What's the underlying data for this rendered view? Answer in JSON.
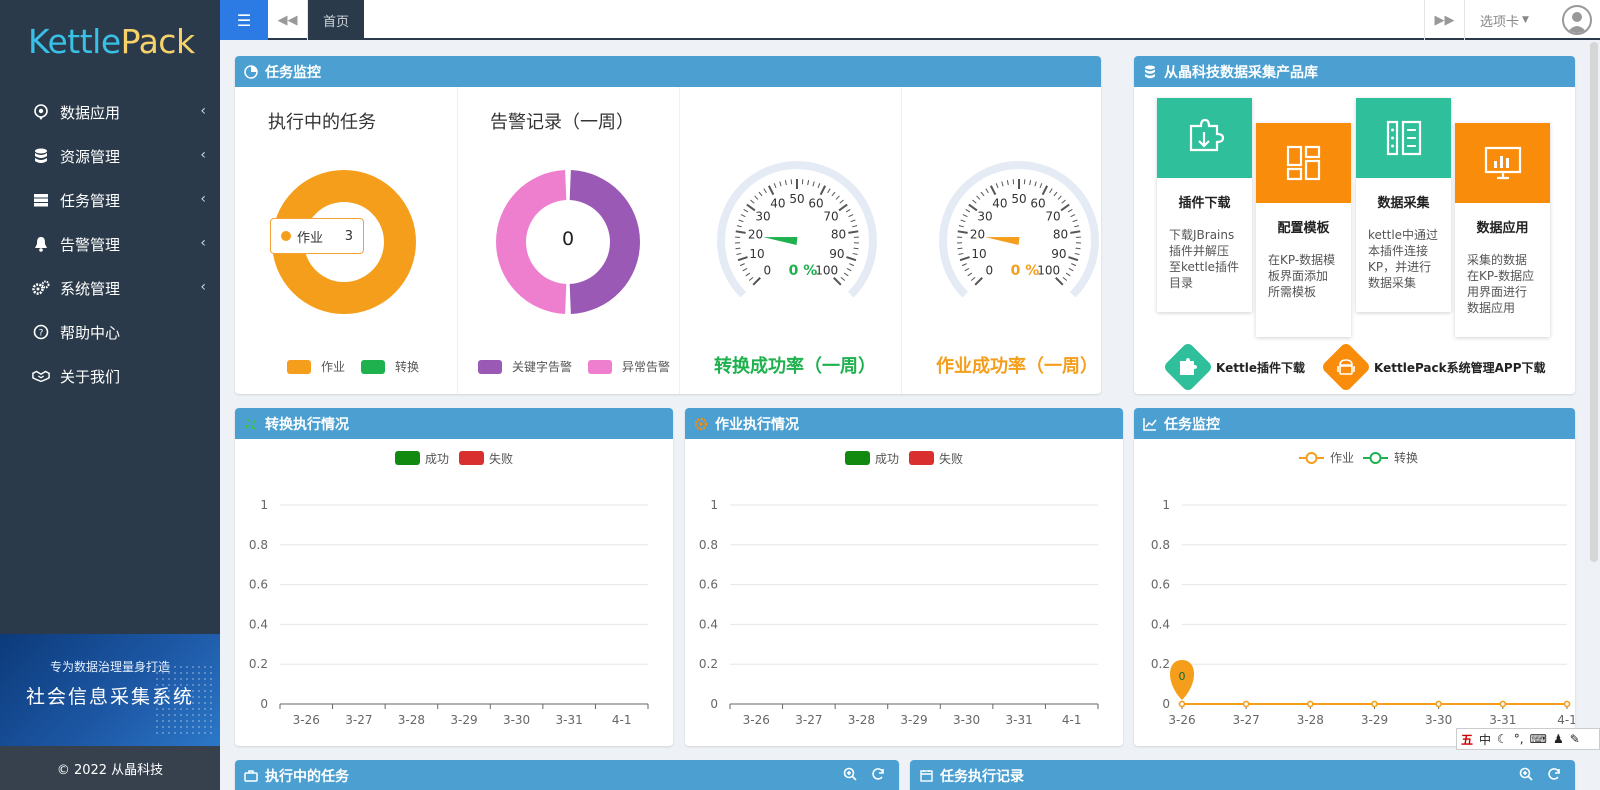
{
  "sidebar": {
    "logo_kettle": "Kettle",
    "logo_pack": "Pack",
    "items": [
      {
        "label": "数据应用",
        "icon": "location-pin-icon",
        "has_children": true
      },
      {
        "label": "资源管理",
        "icon": "database-icon",
        "has_children": true
      },
      {
        "label": "任务管理",
        "icon": "server-icon",
        "has_children": true
      },
      {
        "label": "告警管理",
        "icon": "bell-icon",
        "has_children": true
      },
      {
        "label": "系统管理",
        "icon": "gears-icon",
        "has_children": true
      },
      {
        "label": "帮助中心",
        "icon": "question-circle-icon",
        "has_children": false
      },
      {
        "label": "关于我们",
        "icon": "handshake-icon",
        "has_children": false
      }
    ],
    "banner_line1": "专为数据治理量身打造",
    "banner_line2": "社会信息采集系统",
    "footer": "© 2022 从晶科技"
  },
  "topbar": {
    "home_tab": "首页",
    "tab_dropdown": "选项卡"
  },
  "task_monitor": {
    "title": "任务监控",
    "running_title": "执行中的任务",
    "tooltip_label": "作业",
    "tooltip_value": "3",
    "running_legend": [
      "作业",
      "转换"
    ],
    "alarm_title": "告警记录（一周）",
    "alarm_value": "0",
    "alarm_legend": [
      "关键字告警",
      "异常告警"
    ],
    "transform_rate_label": "转换成功率（一周）",
    "job_rate_label": "作业成功率（一周）",
    "gauge_value_text": "0 %",
    "gauge_ticks": [
      "0",
      "10",
      "20",
      "30",
      "40",
      "50",
      "60",
      "70",
      "80",
      "90",
      "100"
    ]
  },
  "products": {
    "title": "从晶科技数据采集产品库",
    "cards": [
      {
        "title": "插件下载",
        "desc": "下载JBrains插件并解压至kettle插件目录",
        "color": "#2fbf9a"
      },
      {
        "title": "配置模板",
        "desc": "在KP-数据模板界面添加所需模板",
        "color": "#f98c0a"
      },
      {
        "title": "数据采集",
        "desc": "kettle中通过本插件连接KP，并进行数据采集",
        "color": "#2fbf9a"
      },
      {
        "title": "数据应用",
        "desc": "采集的数据在KP-数据应用界面进行数据应用",
        "color": "#f98c0a"
      }
    ],
    "download1": "Kettle插件下载",
    "download2": "KettlePack系统管理APP下载"
  },
  "charts": {
    "transform_exec": {
      "title": "转换执行情况",
      "legend": [
        "成功",
        "失败"
      ]
    },
    "job_exec": {
      "title": "作业执行情况",
      "legend": [
        "成功",
        "失败"
      ]
    },
    "monitor_line": {
      "title": "任务监控",
      "legend": [
        "作业",
        "转换"
      ],
      "marker_value": "0"
    }
  },
  "bottom": {
    "running_tasks": "执行中的任务",
    "task_records": "任务执行记录"
  },
  "ime": {
    "lang": "中"
  },
  "chart_data": [
    {
      "type": "pie",
      "categories": [
        "作业",
        "转换"
      ],
      "values": [
        3,
        0
      ],
      "colors": [
        "#f59e1b",
        "#1fb14e"
      ]
    },
    {
      "type": "pie",
      "categories": [
        "关键字告警",
        "异常告警"
      ],
      "values": [
        0,
        0
      ],
      "colors": [
        "#9b59b6",
        "#ee7fcf"
      ]
    },
    {
      "type": "gauge",
      "title": "转换成功率（一周）",
      "value": 0,
      "range": [
        0,
        100
      ],
      "color": "#1fb14e"
    },
    {
      "type": "gauge",
      "title": "作业成功率（一周）",
      "value": 0,
      "range": [
        0,
        100
      ],
      "color": "#f59e1b"
    },
    {
      "type": "bar",
      "categories": [
        "3-26",
        "3-27",
        "3-28",
        "3-29",
        "3-30",
        "3-31",
        "4-1"
      ],
      "series": [
        {
          "name": "成功",
          "values": [
            0,
            0,
            0,
            0,
            0,
            0,
            0
          ],
          "color": "#118a0f"
        },
        {
          "name": "失败",
          "values": [
            0,
            0,
            0,
            0,
            0,
            0,
            0
          ],
          "color": "#d92f2f"
        }
      ],
      "ylim": [
        0,
        1
      ],
      "yticks": [
        "0",
        "0.2",
        "0.4",
        "0.6",
        "0.8",
        "1"
      ],
      "legend": "top-center",
      "grid": true
    },
    {
      "type": "bar",
      "categories": [
        "3-26",
        "3-27",
        "3-28",
        "3-29",
        "3-30",
        "3-31",
        "4-1"
      ],
      "series": [
        {
          "name": "成功",
          "values": [
            0,
            0,
            0,
            0,
            0,
            0,
            0
          ],
          "color": "#118a0f"
        },
        {
          "name": "失败",
          "values": [
            0,
            0,
            0,
            0,
            0,
            0,
            0
          ],
          "color": "#d92f2f"
        }
      ],
      "ylim": [
        0,
        1
      ],
      "yticks": [
        "0",
        "0.2",
        "0.4",
        "0.6",
        "0.8",
        "1"
      ],
      "legend": "top-center",
      "grid": true
    },
    {
      "type": "line",
      "categories": [
        "3-26",
        "3-27",
        "3-28",
        "3-29",
        "3-30",
        "3-31",
        "4-1"
      ],
      "series": [
        {
          "name": "作业",
          "values": [
            0,
            0,
            0,
            0,
            0,
            0,
            0
          ],
          "color": "#f59e1b"
        },
        {
          "name": "转换",
          "values": [
            0,
            0,
            0,
            0,
            0,
            0,
            0
          ],
          "color": "#1fb14e"
        }
      ],
      "ylim": [
        0,
        1
      ],
      "yticks": [
        "0",
        "0.2",
        "0.4",
        "0.6",
        "0.8",
        "1"
      ],
      "legend": "top-center",
      "grid": true
    }
  ]
}
